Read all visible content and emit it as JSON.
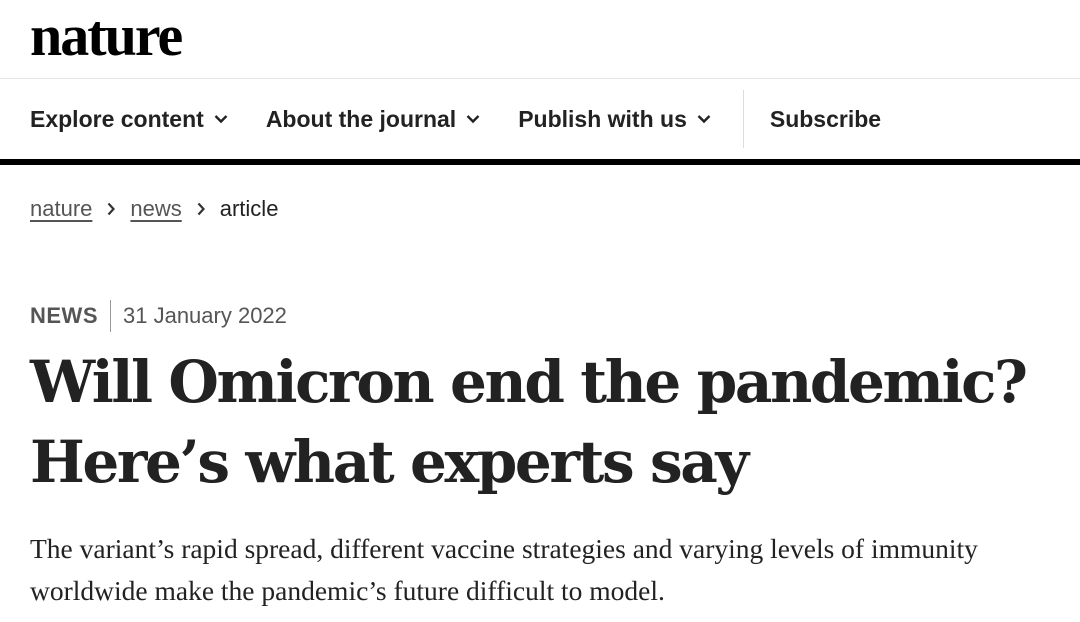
{
  "header": {
    "logo_text": "nature"
  },
  "nav": {
    "items": [
      {
        "label": "Explore content",
        "icon": "chevron-down-icon"
      },
      {
        "label": "About the journal",
        "icon": "chevron-down-icon"
      },
      {
        "label": "Publish with us",
        "icon": "chevron-down-icon"
      }
    ],
    "subscribe_label": "Subscribe"
  },
  "breadcrumb": {
    "items": [
      {
        "label": "nature",
        "link": true
      },
      {
        "label": "news",
        "link": true
      },
      {
        "label": "article",
        "link": false
      }
    ],
    "separator_icon": "chevron-right-icon"
  },
  "article": {
    "type": "NEWS",
    "date": "31 January 2022",
    "title": "Will Omicron end the pandemic? Here’s what experts say",
    "standfirst": "The variant’s rapid spread, different vaccine strategies and varying levels of immunity worldwide make the pandemic’s future difficult to model."
  },
  "colors": {
    "text": "#222222",
    "muted": "#555555",
    "nav_rule": "#000000",
    "divider": "#e6e6e6"
  }
}
